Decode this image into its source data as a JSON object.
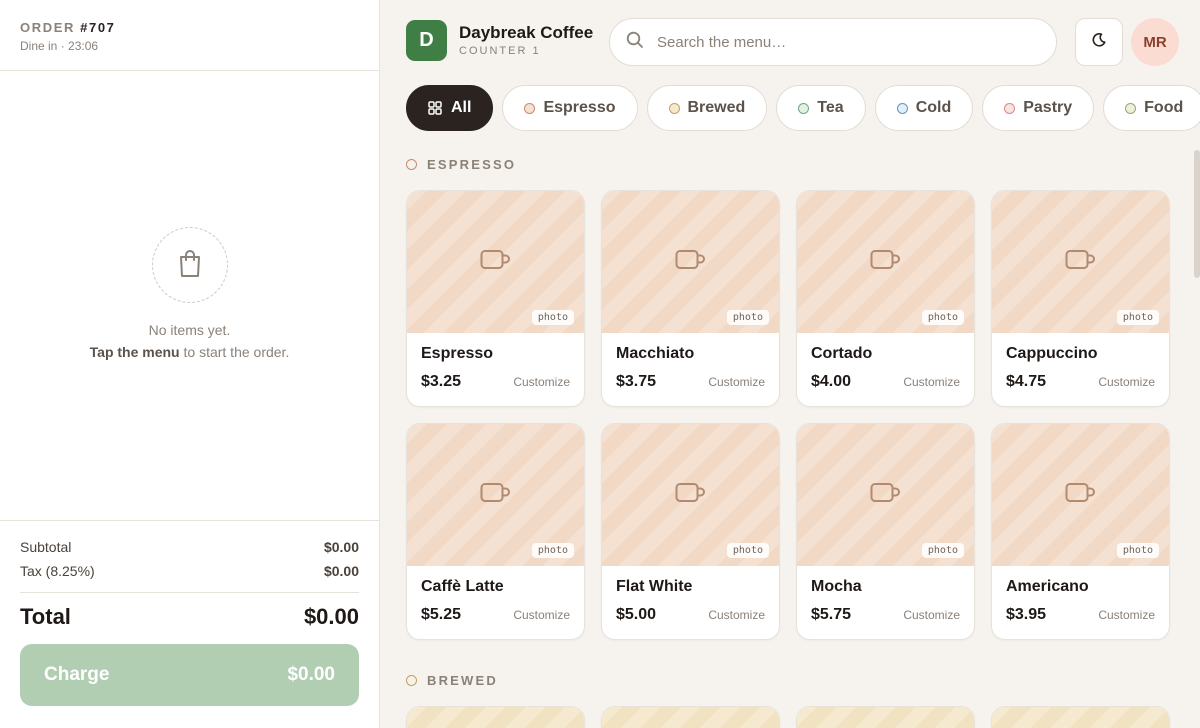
{
  "order": {
    "label": "ORDER",
    "number": "#707",
    "subtitle": "Dine in · 23:06",
    "empty_line1": "No items yet.",
    "empty_strong": "Tap the menu",
    "empty_rest": " to start the order.",
    "subtotal_label": "Subtotal",
    "subtotal_value": "$0.00",
    "tax_label": "Tax (8.25%)",
    "tax_value": "$0.00",
    "total_label": "Total",
    "total_value": "$0.00",
    "charge_label": "Charge",
    "charge_value": "$0.00"
  },
  "header": {
    "logo_letter": "D",
    "brand_name": "Daybreak Coffee",
    "brand_sub": "COUNTER 1",
    "search_placeholder": "Search the menu…",
    "avatar_initials": "MR"
  },
  "categories": [
    {
      "label": "All",
      "active": true
    },
    {
      "label": "Espresso",
      "dot_color": "#c98b6e",
      "dot_fill": "#f5e1d2"
    },
    {
      "label": "Brewed",
      "dot_color": "#c4a062",
      "dot_fill": "#f5ead0"
    },
    {
      "label": "Tea",
      "dot_color": "#6fa881",
      "dot_fill": "#e3f0e4"
    },
    {
      "label": "Cold",
      "dot_color": "#5a97c8",
      "dot_fill": "#e2eef8"
    },
    {
      "label": "Pastry",
      "dot_color": "#d98a8a",
      "dot_fill": "#f9e2e0"
    },
    {
      "label": "Food",
      "dot_color": "#a0a56a",
      "dot_fill": "#eef0dc"
    }
  ],
  "sections": {
    "espresso": {
      "title": "ESPRESSO",
      "dot_color": "#c98b6e",
      "items": [
        {
          "name": "Espresso",
          "price": "$3.25",
          "customize": "Customize",
          "photo": "photo"
        },
        {
          "name": "Macchiato",
          "price": "$3.75",
          "customize": "Customize",
          "photo": "photo"
        },
        {
          "name": "Cortado",
          "price": "$4.00",
          "customize": "Customize",
          "photo": "photo"
        },
        {
          "name": "Cappuccino",
          "price": "$4.75",
          "customize": "Customize",
          "photo": "photo"
        },
        {
          "name": "Caffè Latte",
          "price": "$5.25",
          "customize": "Customize",
          "photo": "photo"
        },
        {
          "name": "Flat White",
          "price": "$5.00",
          "customize": "Customize",
          "photo": "photo"
        },
        {
          "name": "Mocha",
          "price": "$5.75",
          "customize": "Customize",
          "photo": "photo"
        },
        {
          "name": "Americano",
          "price": "$3.95",
          "customize": "Customize",
          "photo": "photo"
        }
      ]
    },
    "brewed": {
      "title": "BREWED",
      "dot_color": "#c4a062"
    }
  },
  "icons": {
    "search": "search-icon",
    "theme": "moon-icon",
    "empty": "shopping-bag-icon",
    "all": "grid-icon",
    "card": "cup-icon"
  }
}
